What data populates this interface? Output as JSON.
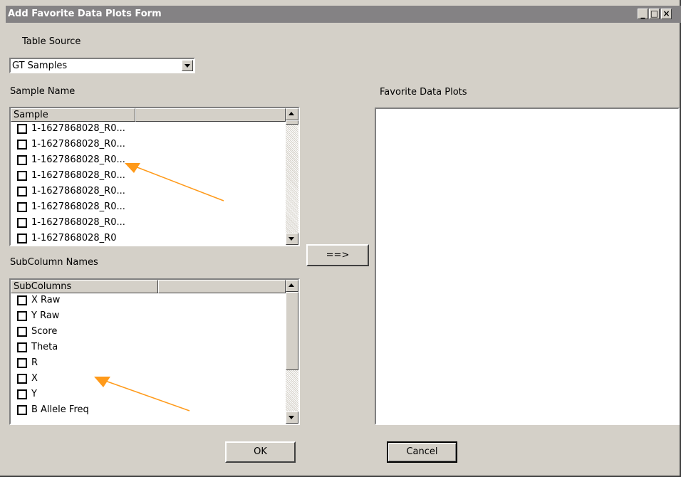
{
  "window": {
    "title": "Add Favorite Data Plots Form",
    "min_glyph": "_",
    "max_glyph": "□",
    "close_glyph": "×"
  },
  "table_source": {
    "label": "Table Source",
    "selected": "GT Samples"
  },
  "sample_list": {
    "label": "Sample Name",
    "header": "Sample",
    "items": [
      "1-1627868028_R0...",
      "1-1627868028_R0...",
      "1-1627868028_R0...",
      "1-1627868028_R0...",
      "1-1627868028_R0...",
      "1-1627868028_R0...",
      "1-1627868028_R0...",
      "1-1627868028_R0"
    ]
  },
  "subcolumn_list": {
    "label": "SubColumn Names",
    "header": "SubColumns",
    "items": [
      "X Raw",
      "Y Raw",
      "Score",
      "Theta",
      "R",
      "X",
      "Y",
      "B Allele Freq"
    ]
  },
  "transfer_button": "==>",
  "favorites": {
    "label": "Favorite Data Plots"
  },
  "buttons": {
    "ok": "OK",
    "cancel": "Cancel"
  },
  "colors": {
    "annotation_arrow": "#ff9a1a",
    "window_bg": "#d4d0c8",
    "title_bar": "#848284"
  }
}
